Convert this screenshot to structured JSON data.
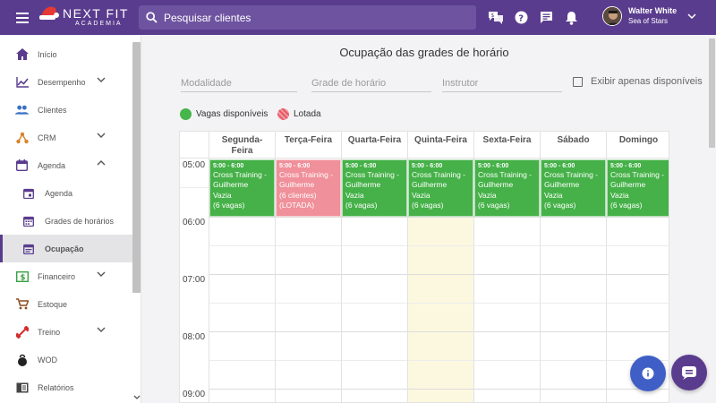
{
  "header": {
    "logo_main": "NEXT FIT",
    "logo_sub": "ACADEMIA",
    "search_placeholder": "Pesquisar clientes",
    "user_name": "Walter White",
    "user_sub": "Sea of Stars"
  },
  "sidebar": {
    "items": [
      {
        "label": "Início",
        "icon": "home-icon"
      },
      {
        "label": "Desempenho",
        "icon": "chart-line-icon",
        "chevron": "down"
      },
      {
        "label": "Clientes",
        "icon": "people-icon"
      },
      {
        "label": "CRM",
        "icon": "crm-network-icon",
        "chevron": "down"
      },
      {
        "label": "Agenda",
        "icon": "calendar-icon",
        "chevron": "up"
      },
      {
        "label": "Agenda",
        "icon": "calendar-icon",
        "sub": true
      },
      {
        "label": "Grades de horários",
        "icon": "calendar-grid-icon",
        "sub": true
      },
      {
        "label": "Ocupação",
        "icon": "calendar-list-icon",
        "sub": true,
        "active": true
      },
      {
        "label": "Financeiro",
        "icon": "money-icon",
        "chevron": "down"
      },
      {
        "label": "Estoque",
        "icon": "cart-icon"
      },
      {
        "label": "Treino",
        "icon": "dumbbell-icon",
        "chevron": "down"
      },
      {
        "label": "WOD",
        "icon": "kettlebell-icon"
      },
      {
        "label": "Relatórios",
        "icon": "report-icon"
      }
    ]
  },
  "main": {
    "title": "Ocupação das grades de horário",
    "filters": {
      "modalidade": "Modalidade",
      "grade": "Grade de horário",
      "instrutor": "Instrutor",
      "only_available": "Exibir apenas disponíveis"
    },
    "legend": {
      "available": "Vagas disponíveis",
      "full": "Lotada"
    }
  },
  "calendar": {
    "days": [
      [
        "Segunda-",
        "Feira"
      ],
      [
        "Terça-Feira"
      ],
      [
        "Quarta-Feira"
      ],
      [
        "Quinta-Feira"
      ],
      [
        "Sexta-Feira"
      ],
      [
        "Sábado"
      ],
      [
        "Domingo"
      ]
    ],
    "times": [
      "05:00",
      "06:00",
      "07:00",
      "08:00",
      "09:00"
    ],
    "events": [
      {
        "time": "5:00 - 6:00",
        "lines": [
          "Cross Training -",
          "Guilherme",
          "Vazia",
          "(6 vagas)"
        ],
        "status": "available"
      },
      {
        "time": "5:00 - 6:00",
        "lines": [
          "Cross Training -",
          "Guilherme",
          "(6 clientes)",
          "(LOTADA)"
        ],
        "status": "full"
      },
      {
        "time": "5:00 - 6:00",
        "lines": [
          "Cross Training -",
          "Guilherme",
          "Vazia",
          "(6 vagas)"
        ],
        "status": "available"
      },
      {
        "time": "5:00 - 6:00",
        "lines": [
          "Cross Training -",
          "Guilherme",
          "Vazia",
          "(6 vagas)"
        ],
        "status": "available"
      },
      {
        "time": "5:00 - 6:00",
        "lines": [
          "Cross Training -",
          "Guilherme",
          "Vazia",
          "(6 vagas)"
        ],
        "status": "available"
      },
      {
        "time": "5:00 - 6:00",
        "lines": [
          "Cross Training -",
          "Guilherme",
          "Vazia",
          "(6 vagas)"
        ],
        "status": "available"
      },
      {
        "time": "5:00 - 6:00",
        "lines": [
          "Cross Training -",
          "Guilherme",
          "Vazia",
          "(6 vagas)"
        ],
        "status": "available"
      }
    ],
    "today_index": 3
  },
  "colors": {
    "primary": "#5a3c8e",
    "available": "#45b148",
    "full": "#f0909a",
    "today": "#fbf8df"
  }
}
